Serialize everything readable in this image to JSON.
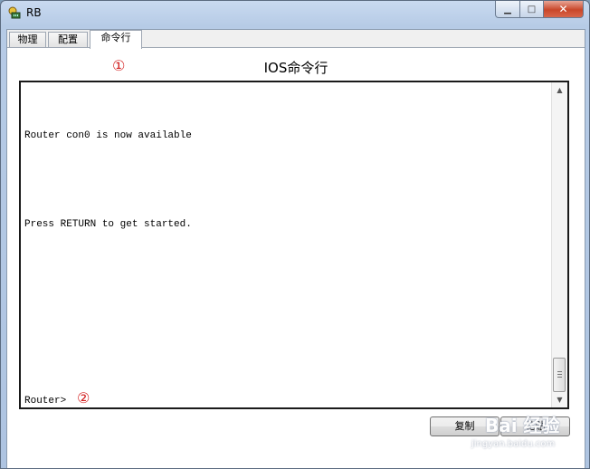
{
  "window": {
    "title": "RB"
  },
  "tabs": [
    {
      "label": "物理",
      "active": false
    },
    {
      "label": "配置",
      "active": false
    },
    {
      "label": "命令行",
      "active": true
    }
  ],
  "annotations": {
    "marker1": "①",
    "marker2": "②"
  },
  "panel": {
    "heading": "IOS命令行"
  },
  "console": {
    "lines": [
      "Router con0 is now available",
      "Press RETURN to get started.",
      "Router>"
    ]
  },
  "buttons": {
    "copy": "复制",
    "paste": "粘贴"
  },
  "watermark": {
    "logo": "Bai 经验",
    "url": "jingyan.baidu.com"
  },
  "colors": {
    "marker": "#d32020",
    "close_button": "#c9472a"
  }
}
